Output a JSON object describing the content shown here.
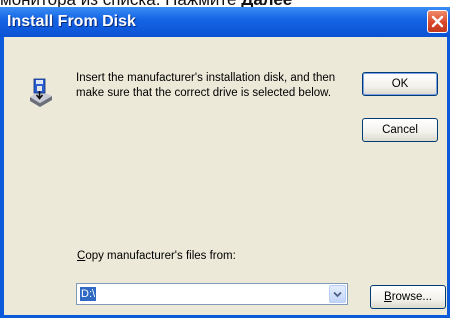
{
  "background_caption": {
    "prefix": "монитора из списка. Нажмите ",
    "bold": "Далее"
  },
  "dialog": {
    "title": "Install From Disk",
    "message_line1": "Insert the manufacturer's installation disk, and then",
    "message_line2": "make sure that the correct drive is selected below.",
    "ok_label": "OK",
    "cancel_label": "Cancel",
    "copy_label_first": "C",
    "copy_label_rest": "opy manufacturer's files from:",
    "path_value": "D:\\",
    "browse_label_first": "B",
    "browse_label_rest": "rowse..."
  },
  "icons": {
    "close": "close-icon",
    "disk": "disk-drive-icon",
    "dropdown": "chevron-down-icon"
  },
  "colors": {
    "titlebar": "#0a52d4",
    "client": "#ece9d8",
    "close_button": "#d9482a",
    "selection": "#316ac5"
  }
}
